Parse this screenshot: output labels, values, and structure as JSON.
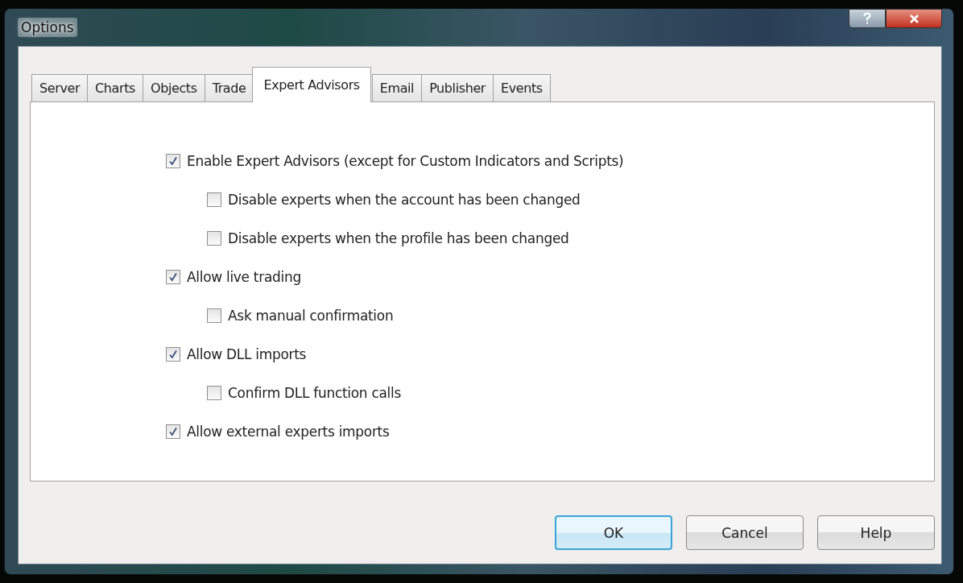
{
  "window": {
    "title": "Options"
  },
  "tabs": [
    {
      "label": "Server",
      "selected": false
    },
    {
      "label": "Charts",
      "selected": false
    },
    {
      "label": "Objects",
      "selected": false
    },
    {
      "label": "Trade",
      "selected": false
    },
    {
      "label": "Expert Advisors",
      "selected": true
    },
    {
      "label": "Email",
      "selected": false
    },
    {
      "label": "Publisher",
      "selected": false
    },
    {
      "label": "Events",
      "selected": false
    }
  ],
  "options": [
    {
      "label": "Enable Expert Advisors (except for Custom Indicators and Scripts)",
      "checked": true,
      "children": [
        {
          "label": "Disable experts when the account has been changed",
          "checked": false
        },
        {
          "label": "Disable experts when the profile has been changed",
          "checked": false
        }
      ]
    },
    {
      "label": "Allow live trading",
      "checked": true,
      "children": [
        {
          "label": "Ask manual confirmation",
          "checked": false
        }
      ]
    },
    {
      "label": "Allow DLL imports",
      "checked": true,
      "children": [
        {
          "label": "Confirm DLL function calls",
          "checked": false
        }
      ]
    },
    {
      "label": "Allow external experts imports",
      "checked": true
    }
  ],
  "buttons": [
    {
      "label": "OK",
      "focused": true
    },
    {
      "label": "Cancel",
      "focused": false
    },
    {
      "label": "Help",
      "focused": false
    }
  ]
}
